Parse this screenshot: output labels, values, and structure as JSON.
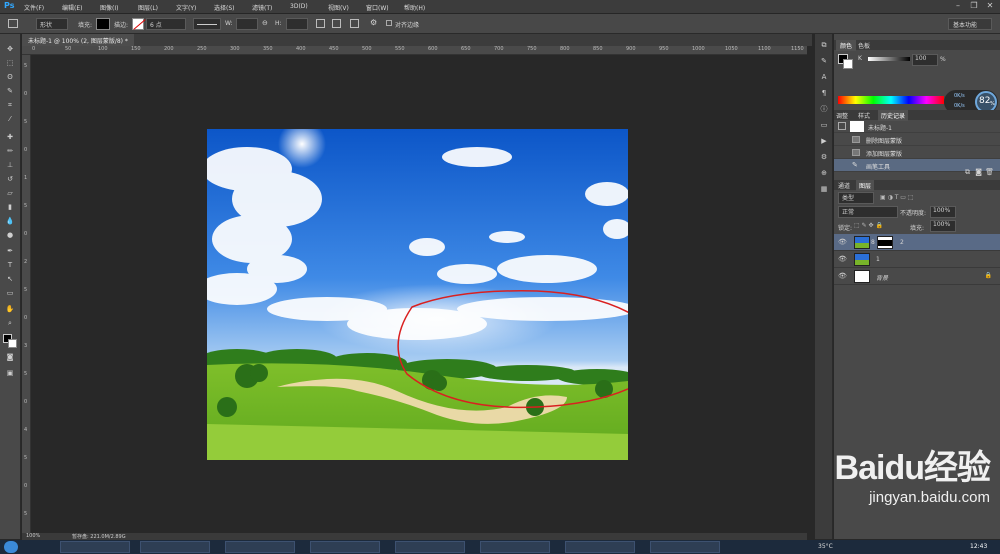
{
  "app": {
    "logo": "Ps"
  },
  "menu": [
    "文件(F)",
    "编辑(E)",
    "图像(I)",
    "图层(L)",
    "文字(Y)",
    "选择(S)",
    "滤镜(T)",
    "3D(D)",
    "视图(V)",
    "窗口(W)",
    "帮助(H)"
  ],
  "options": {
    "shape": "形状",
    "fill_label": "填充:",
    "stroke_label": "描边:",
    "stroke_size": "6 点",
    "w_label": "W:",
    "h_label": "H:",
    "align_edges": "对齐边缘",
    "workspace": "基本功能"
  },
  "document": {
    "tab": "未标题-1 @ 100% (2, 图层蒙版/8) *"
  },
  "ruler": {
    "h": [
      "0",
      "50",
      "100",
      "150",
      "200",
      "250",
      "300",
      "350",
      "400",
      "450",
      "500",
      "550",
      "600",
      "650",
      "700",
      "750",
      "800",
      "850",
      "900",
      "950",
      "1000",
      "1050",
      "1100",
      "1150"
    ],
    "v": [
      "5",
      "0",
      "5",
      "0",
      "1",
      "5",
      "0",
      "2",
      "5",
      "0",
      "3",
      "5",
      "0",
      "4",
      "5",
      "0",
      "5"
    ]
  },
  "status": {
    "zoom": "100%",
    "info": "暂存盘: 221.0M/2.89G"
  },
  "panels": {
    "color_tabs": [
      "颜色",
      "色板"
    ],
    "k_label": "K",
    "k_value": "100",
    "k_unit": "%",
    "mid_tabs": [
      "调整",
      "样式",
      "历史记录"
    ],
    "history_doc": "未标题-1",
    "history": [
      "删除图层蒙版",
      "添加图层蒙版",
      "画笔工具"
    ],
    "layer_tabs": [
      "通道",
      "图层"
    ],
    "kind": "类型",
    "blend": "正常",
    "opacity_label": "不透明度:",
    "opacity": "100%",
    "lock_label": "锁定:",
    "fill_label": "填充:",
    "fill": "100%",
    "layers": [
      {
        "name": "2"
      },
      {
        "name": "1"
      },
      {
        "name": "背景"
      }
    ],
    "perf_value": "82",
    "perf_unit": "%",
    "net_up": "0K/s",
    "net_down": "0K/s"
  },
  "taskbar": {
    "time": "12:43",
    "temp": "35°C"
  },
  "watermark": {
    "brand": "Baidu经验",
    "url": "jingyan.baidu.com"
  }
}
